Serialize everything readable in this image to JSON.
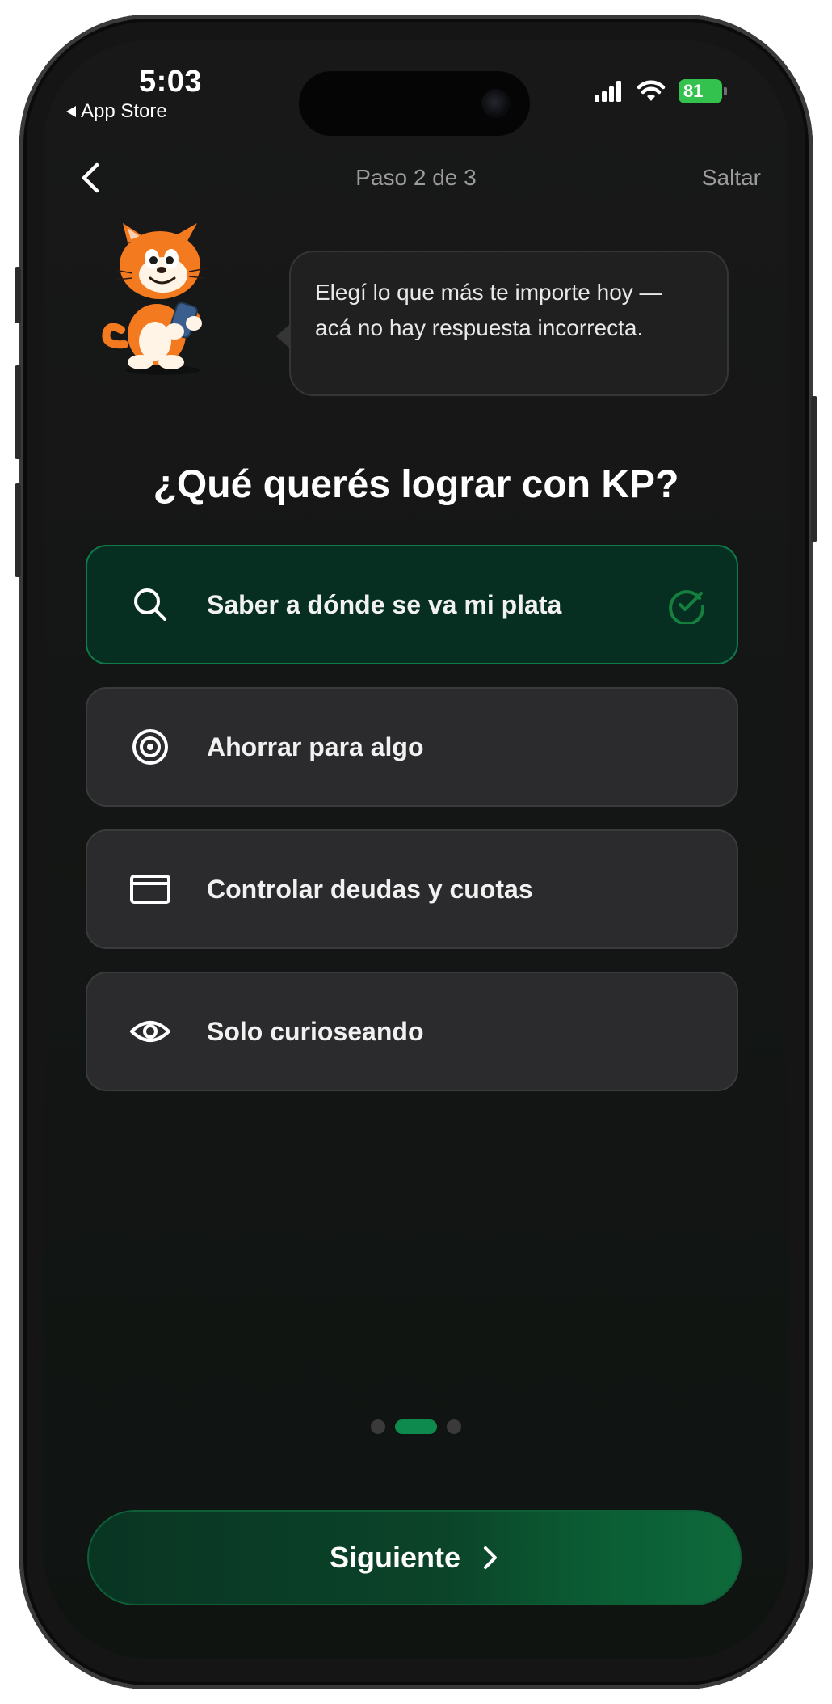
{
  "status_bar": {
    "time": "5:03",
    "back_app": "App Store",
    "battery": "81"
  },
  "header": {
    "step": "Paso 2 de 3",
    "skip": "Saltar"
  },
  "bubble": {
    "text": "Elegí lo que más te importe hoy — acá no hay respuesta incorrecta."
  },
  "question": "¿Qué querés lograr con KP?",
  "options": [
    {
      "label": "Saber a dónde se va mi plata",
      "icon": "search-icon",
      "selected": true
    },
    {
      "label": "Ahorrar para algo",
      "icon": "target-icon",
      "selected": false
    },
    {
      "label": "Controlar deudas y cuotas",
      "icon": "credit-card-icon",
      "selected": false
    },
    {
      "label": "Solo curioseando",
      "icon": "eye-icon",
      "selected": false
    }
  ],
  "pagination": {
    "total": 3,
    "current": 2
  },
  "cta": {
    "label": "Siguiente"
  },
  "colors": {
    "background": "#141615",
    "option": "#2b2b2d",
    "selected_option": "#062f22",
    "accent_green": "#0f8a4e"
  }
}
